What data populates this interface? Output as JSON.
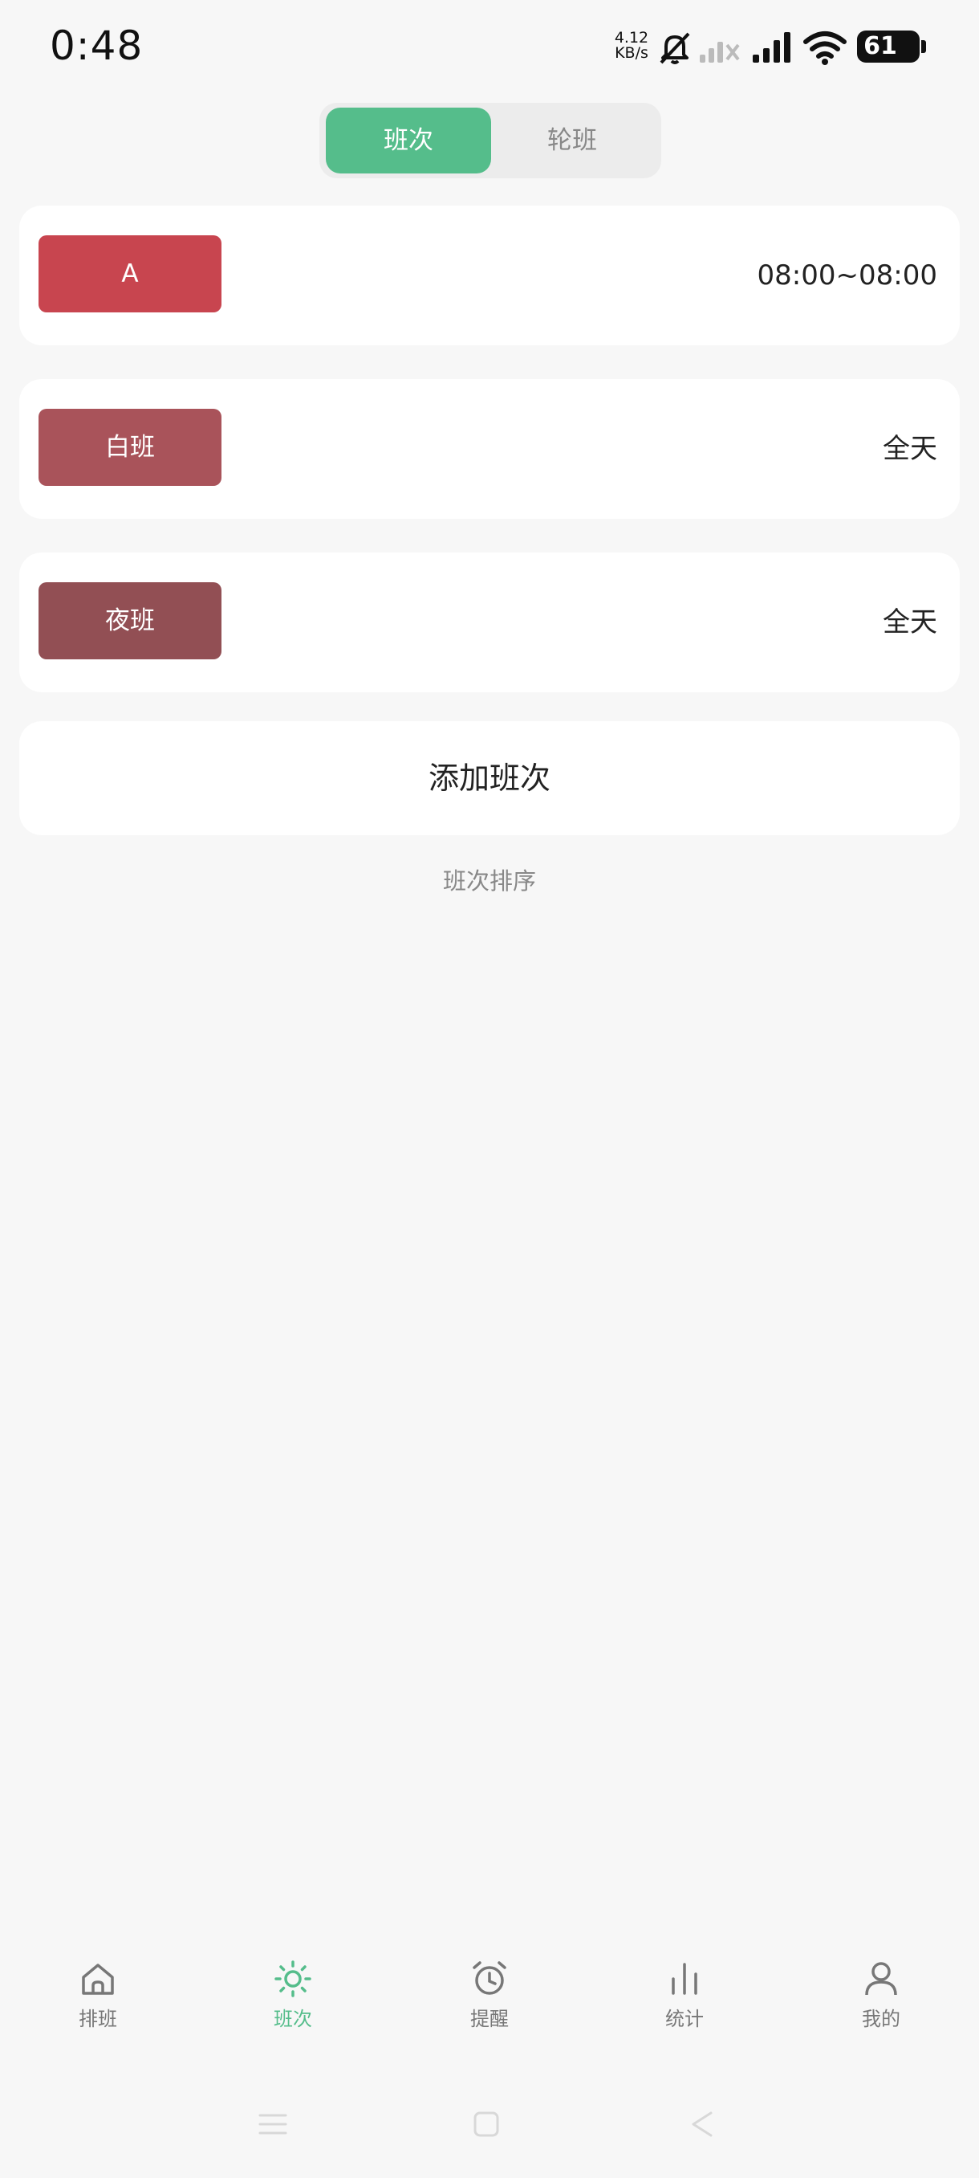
{
  "status_bar": {
    "time": "0:48",
    "net_speed_value": "4.12",
    "net_speed_unit": "KB/s",
    "battery": "61",
    "battery_level": 0.61
  },
  "tabs": [
    {
      "label": "班次",
      "active": true
    },
    {
      "label": "轮班",
      "active": false
    }
  ],
  "shifts": [
    {
      "name": "A",
      "time": "08:00~08:00",
      "color": "#c8454f"
    },
    {
      "name": "白班",
      "time": "全天",
      "color": "#a9535a"
    },
    {
      "name": "夜班",
      "time": "全天",
      "color": "#924f54"
    }
  ],
  "add_shift_label": "添加班次",
  "sort_label": "班次排序",
  "accent_color": "#55bd8b",
  "bottom_nav": [
    {
      "label": "排班",
      "icon": "home-icon",
      "active": false
    },
    {
      "label": "班次",
      "icon": "sun-icon",
      "active": true
    },
    {
      "label": "提醒",
      "icon": "alarm-clock-icon",
      "active": false
    },
    {
      "label": "统计",
      "icon": "bar-chart-icon",
      "active": false
    },
    {
      "label": "我的",
      "icon": "person-icon",
      "active": false
    }
  ]
}
